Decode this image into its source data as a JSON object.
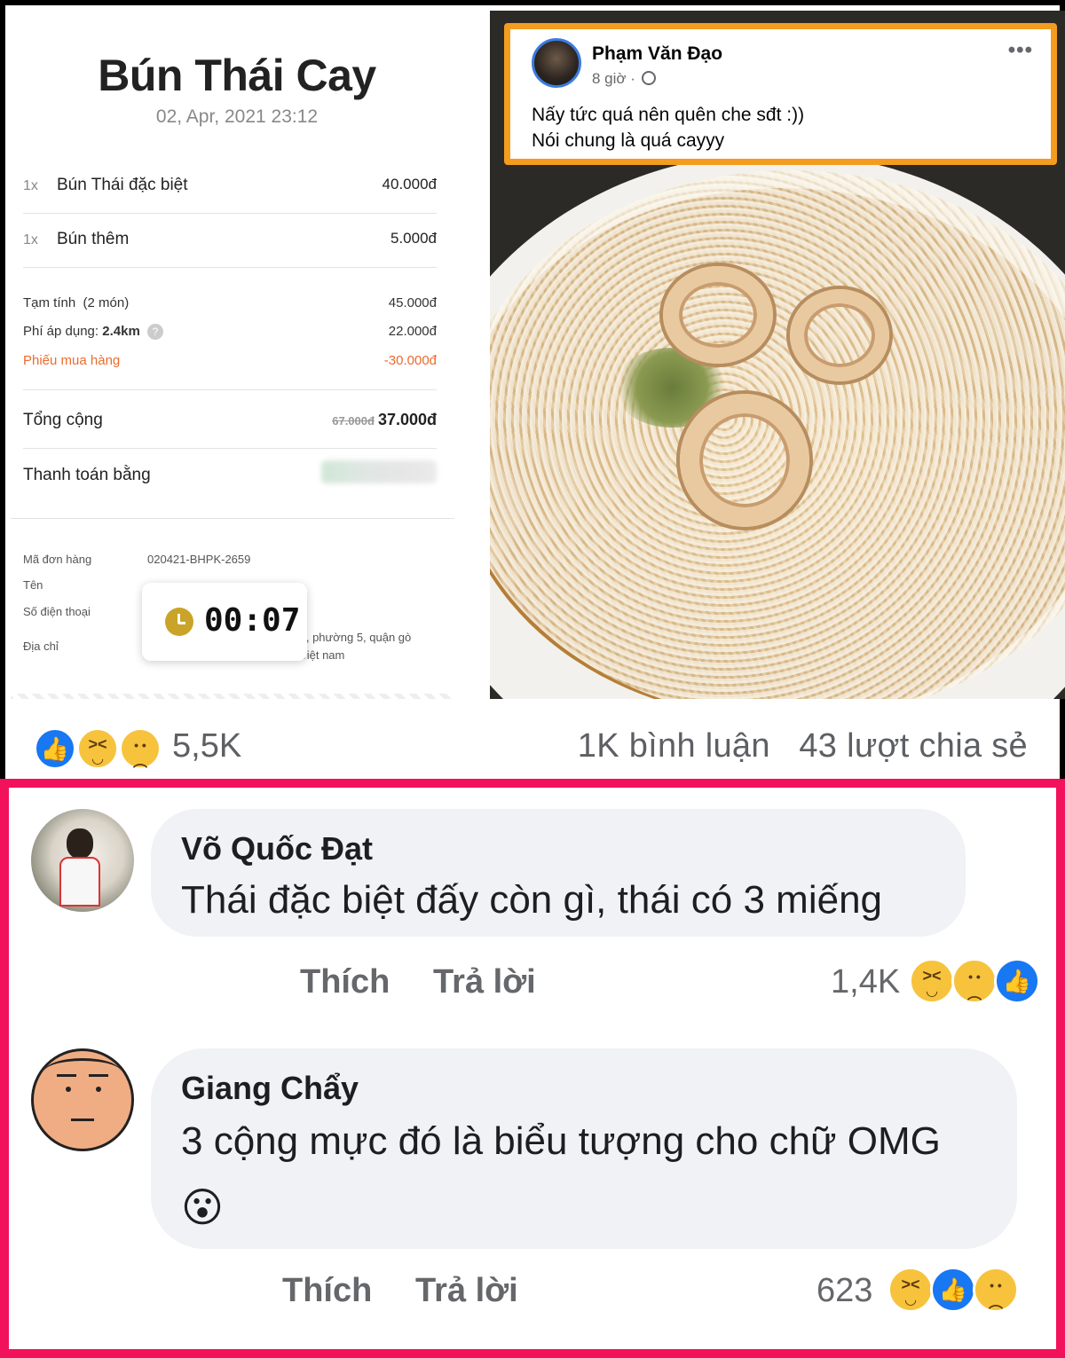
{
  "receipt": {
    "title": "Bún Thái Cay",
    "date": "02, Apr, 2021 23:12",
    "items": [
      {
        "qty": "1x",
        "name": "Bún Thái đặc biệt",
        "price": "40.000đ"
      },
      {
        "qty": "1x",
        "name": "Bún thêm",
        "price": "5.000đ"
      }
    ],
    "subtotal_label": "Tạm tính",
    "subtotal_count": "(2 món)",
    "subtotal_value": "45.000đ",
    "fee_label": "Phí áp dụng:",
    "fee_distance": "2.4km",
    "fee_value": "22.000đ",
    "voucher_label": "Phiếu mua hàng",
    "voucher_value": "-30.000đ",
    "total_label": "Tổng cộng",
    "total_old": "67.000đ",
    "total_value": "37.000đ",
    "payment_label": "Thanh toán bằng",
    "order_id_label": "Mã đơn hàng",
    "order_id": "020421-BHPK-2659",
    "name_label": "Tên",
    "phone_label": "Số điện thoại",
    "address_label": "Địa chỉ",
    "address_line1": "ín, phường 5, quận gò",
    "address_line2": ", việt nam",
    "timer": "00:07",
    "help_icon": "question-circle-icon",
    "clock_icon": "clock-icon"
  },
  "post": {
    "author": "Phạm Văn Đạo",
    "time": "8 giờ ·",
    "privacy_icon": "globe-icon",
    "more_icon": "more-dots-icon",
    "more_label": "•••",
    "text_line1": "Nấy tức quá nên quên che sđt :))",
    "text_line2": "Nói chung là quá cayyy",
    "reaction_count": "5,5K",
    "comments_shares": "1K bình luận   43 lượt chia sẻ",
    "reactions": [
      "like-icon",
      "haha-icon",
      "sad-icon"
    ]
  },
  "comments": [
    {
      "author": "Võ Quốc Đạt",
      "text": "Thái đặc biệt đấy còn gì, thái có 3 miếng",
      "like_label": "Thích",
      "reply_label": "Trả lời",
      "reaction_count": "1,4K",
      "reactions": [
        "haha-icon",
        "sad-icon",
        "like-icon"
      ]
    },
    {
      "author": "Giang Chẩy",
      "text": "3 cộng mực đó là biểu tượng cho chữ OMG",
      "emoji": "😮",
      "like_label": "Thích",
      "reply_label": "Trả lời",
      "reaction_count": "623",
      "reactions": [
        "haha-icon",
        "like-icon",
        "sad-icon"
      ]
    }
  ],
  "colors": {
    "highlight_border": "#f39c1f",
    "section_border": "#f2115b",
    "fb_blue": "#1877f2",
    "voucher_orange": "#ee6a2c"
  }
}
